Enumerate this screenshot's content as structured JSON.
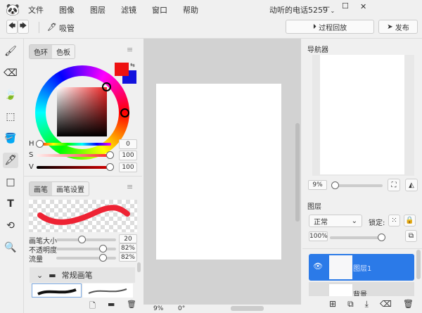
{
  "menu": [
    "文件",
    "图像",
    "图层",
    "滤镜",
    "窗口",
    "帮助"
  ],
  "user": "动听的电话5259",
  "toolbar": {
    "tool_name": "吸管",
    "replay": "过程回放",
    "publish": "发布"
  },
  "color": {
    "tabs": [
      "色环",
      "色板"
    ],
    "h": "0",
    "s": "100",
    "v": "100",
    "h_label": "H",
    "s_label": "S",
    "v_label": "V",
    "primary": "#ee1111",
    "secondary": "#1111dd"
  },
  "brush": {
    "tabs": [
      "画笔",
      "画笔设置"
    ],
    "size_label": "画笔大小",
    "size": "20",
    "opacity_label": "不透明度",
    "opacity": "82%",
    "flow_label": "流量",
    "flow": "82%",
    "group": "常规画笔"
  },
  "status": {
    "zoom": "9%",
    "angle": "0°"
  },
  "navigator": {
    "title": "导航器",
    "zoom": "9%"
  },
  "layers": {
    "title": "图层",
    "blend": "正常",
    "lock_label": "锁定:",
    "opacity": "100%",
    "items": [
      {
        "name": "图层1"
      },
      {
        "name": "背景"
      }
    ]
  }
}
